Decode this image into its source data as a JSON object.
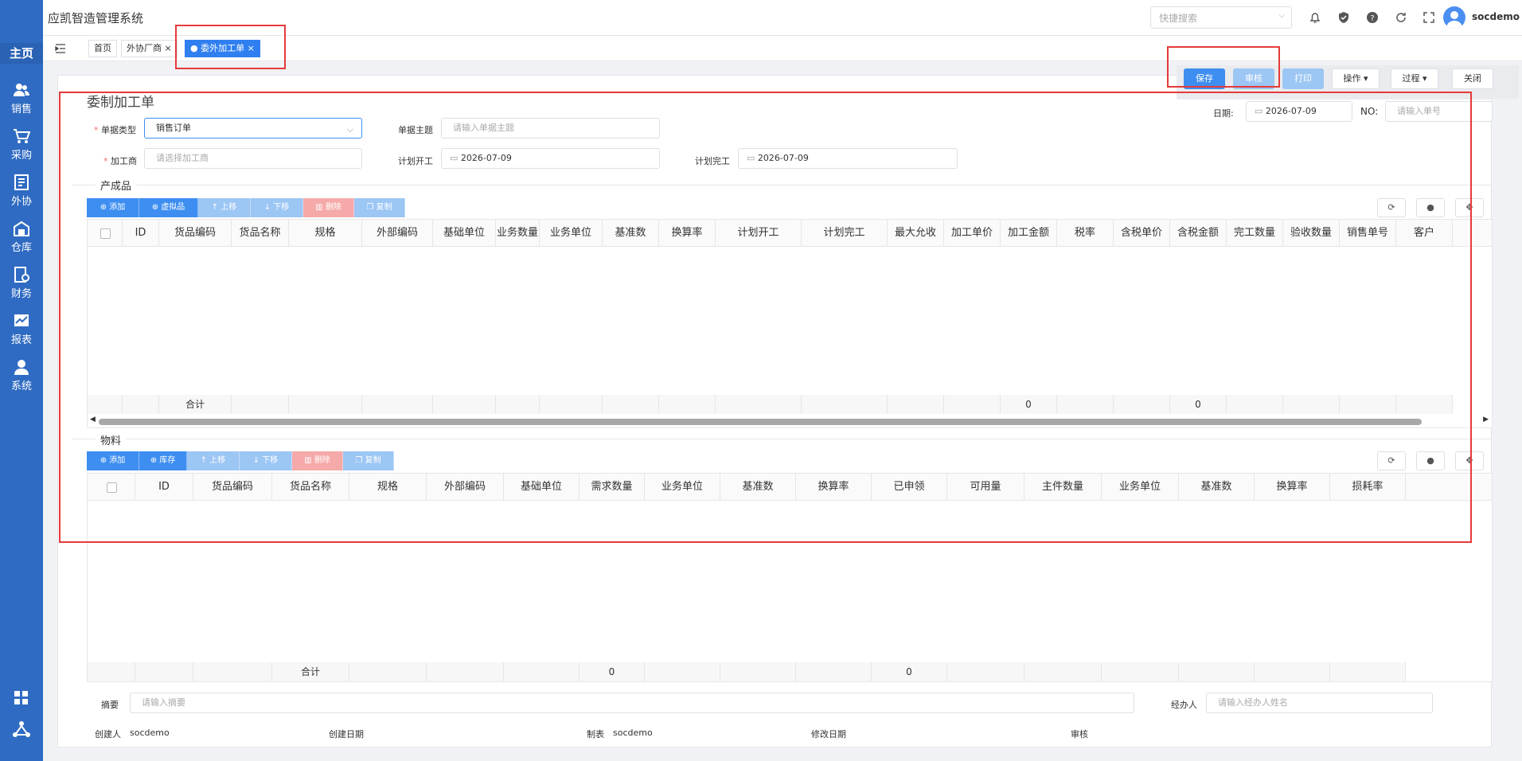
{
  "app": {
    "title": "应凯智造管理系统",
    "search_placeholder": "快捷搜索",
    "username": "socdemo"
  },
  "sidebar": {
    "home": "主页",
    "items": [
      {
        "label": "销售",
        "icon": "people-icon"
      },
      {
        "label": "采购",
        "icon": "cart-icon"
      },
      {
        "label": "外协",
        "icon": "outsource-icon"
      },
      {
        "label": "仓库",
        "icon": "warehouse-icon"
      },
      {
        "label": "财务",
        "icon": "finance-icon"
      },
      {
        "label": "报表",
        "icon": "chart-icon"
      },
      {
        "label": "系统",
        "icon": "user-icon"
      }
    ]
  },
  "tabs": [
    {
      "label": "首页"
    },
    {
      "label": "外协厂商"
    },
    {
      "label": "委外加工单"
    }
  ],
  "toolbar": {
    "save": "保存",
    "audit": "审核",
    "print": "打印",
    "ops": "操作",
    "process": "过程",
    "close": "关闭"
  },
  "form": {
    "title": "委制加工单",
    "doc_type_label": "单据类型",
    "doc_type_value": "销售订单",
    "subject_label": "单据主题",
    "subject_placeholder": "请输入单据主题",
    "date_label": "日期:",
    "date_value": "2026-07-09",
    "no_label": "NO:",
    "no_placeholder": "请输入单号",
    "processor_label": "加工商",
    "processor_placeholder": "请选择加工商",
    "plan_start_label": "计划开工",
    "plan_start_value": "2026-07-09",
    "plan_end_label": "计划完工",
    "plan_end_value": "2026-07-09"
  },
  "products": {
    "section": "产成品",
    "buttons": {
      "add": "添加",
      "virtual": "虚拟品",
      "up": "上移",
      "down": "下移",
      "delete": "删除",
      "copy": "复制"
    },
    "columns": [
      "ID",
      "货品编码",
      "货品名称",
      "规格",
      "外部编码",
      "基础单位",
      "业务数量",
      "业务单位",
      "基准数",
      "换算率",
      "计划开工",
      "计划完工",
      "最大允收",
      "加工单价",
      "加工金额",
      "税率",
      "含税单价",
      "含税金额",
      "完工数量",
      "验收数量",
      "销售单号",
      "客户"
    ],
    "footer": {
      "label": "合计",
      "amount": "0",
      "tax_amount": "0"
    }
  },
  "materials": {
    "section": "物料",
    "buttons": {
      "add": "添加",
      "stock": "库存",
      "up": "上移",
      "down": "下移",
      "delete": "删除",
      "copy": "复制"
    },
    "columns": [
      "ID",
      "货品编码",
      "货品名称",
      "规格",
      "外部编码",
      "基础单位",
      "需求数量",
      "业务单位",
      "基准数",
      "换算率",
      "已申领",
      "可用量",
      "主件数量",
      "业务单位",
      "基准数",
      "换算率",
      "损耗率"
    ],
    "footer": {
      "label": "合计",
      "demand": "0",
      "applied": "0"
    }
  },
  "bottom": {
    "summary_label": "摘要",
    "summary_placeholder": "请输入摘要",
    "handler_label": "经办人",
    "handler_placeholder": "请输入经办人姓名",
    "creator_label": "创建人",
    "creator_value": "socdemo",
    "created_date_label": "创建日期",
    "maker_label": "制表",
    "maker_value": "socdemo",
    "modified_label": "修改日期",
    "audit_label": "审核"
  },
  "colors": {
    "sidebar": "#2f6bc2",
    "primary": "#3d8ef0",
    "annotation": "#e53a3a"
  }
}
